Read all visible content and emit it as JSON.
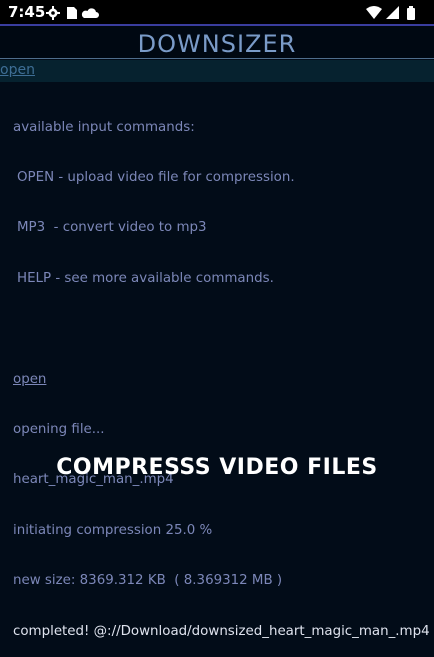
{
  "status": {
    "time": "7:45",
    "icons_left": [
      "settings-gear-icon",
      "sd-card-icon",
      "cloud-icon"
    ],
    "icons_right": [
      "wifi-icon",
      "signal-icon",
      "battery-icon"
    ]
  },
  "header": {
    "title": "DOWNSIZER"
  },
  "command_bar": {
    "value": "open"
  },
  "console": {
    "help_title": "available input commands:",
    "help_items": [
      "OPEN - upload video file for compression.",
      "MP3  - convert video to mp3",
      "HELP - see more available commands."
    ],
    "entered_command": "open",
    "log": [
      "opening file...",
      "heart_magic_man_.mp4",
      "initiating compression 25.0 %",
      "new size: 8369.312 KB  ( 8.369312 MB )"
    ],
    "completed": "completed! @://Download/downsized_heart_magic_man_.mp4"
  },
  "banner": {
    "text": "COMPRESSS VIDEO FILES"
  },
  "colors": {
    "background": "#020c18",
    "title": "#7a9bc8",
    "console_text": "#7c87b8",
    "accent_line": "#3a3d9e"
  }
}
